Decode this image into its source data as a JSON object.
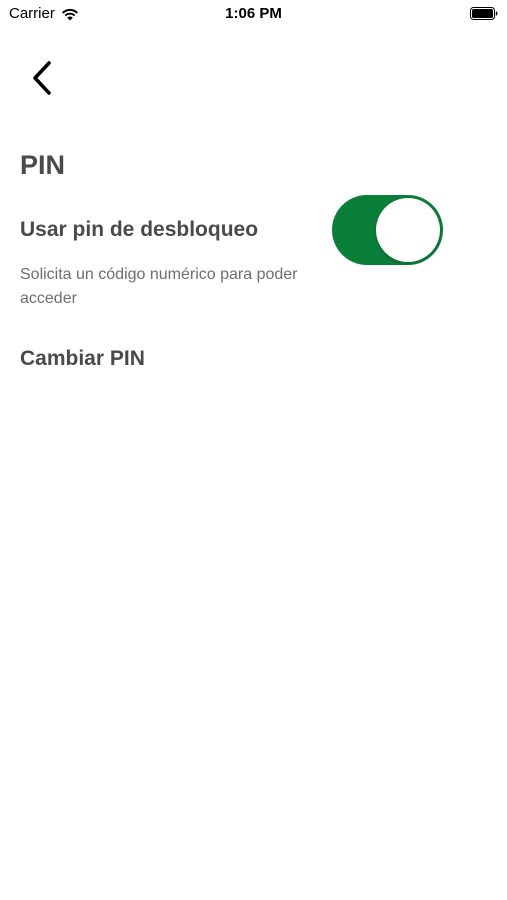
{
  "status_bar": {
    "carrier": "Carrier",
    "time": "1:06 PM",
    "wifi_icon": "wifi-icon",
    "battery_icon": "battery-icon"
  },
  "nav": {
    "back_icon": "chevron-left-icon"
  },
  "section": {
    "title": "PIN"
  },
  "pin_setting": {
    "title": "Usar pin de desbloqueo",
    "description": "Solicita un código numérico para poder acceder",
    "enabled": true,
    "accent_color": "#0a7f3a"
  },
  "change_pin": {
    "label": "Cambiar PIN"
  }
}
